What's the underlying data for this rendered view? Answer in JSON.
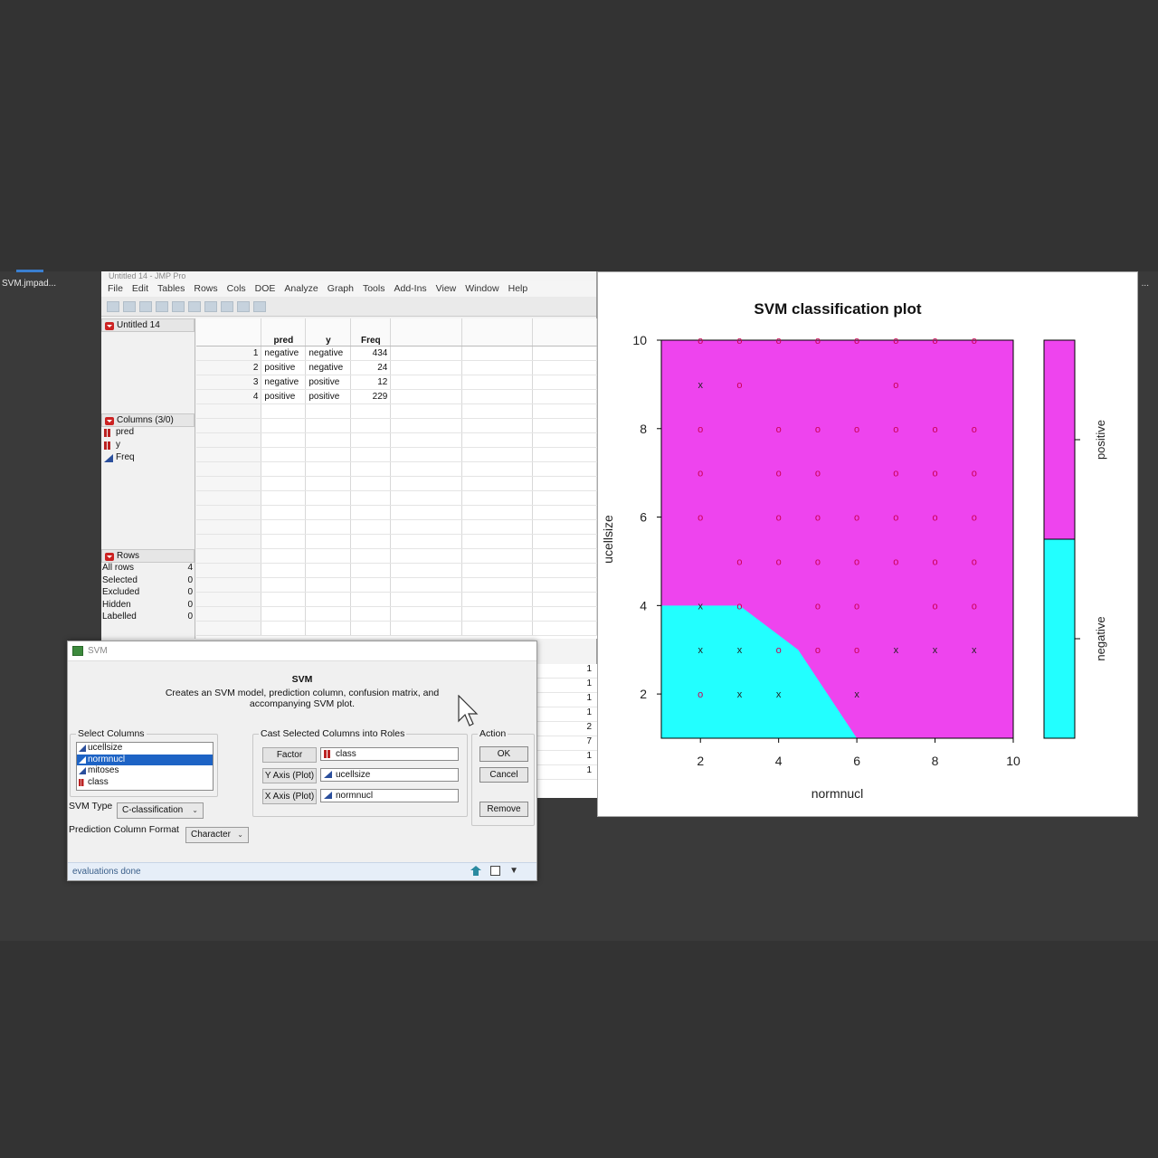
{
  "desktop": {
    "icon_label": "SVM.jmpad...",
    "edge_text": "..."
  },
  "jmp": {
    "title": "Untitled 14 - JMP Pro",
    "menu": [
      "File",
      "Edit",
      "Tables",
      "Rows",
      "Cols",
      "DOE",
      "Analyze",
      "Graph",
      "Tools",
      "Add-Ins",
      "View",
      "Window",
      "Help"
    ],
    "table_name": "Untitled 14",
    "columns_header": "Columns (3/0)",
    "columns": [
      {
        "name": "pred",
        "type": "nominal"
      },
      {
        "name": "y",
        "type": "nominal"
      },
      {
        "name": "Freq",
        "type": "continuous"
      }
    ],
    "rows_header": "Rows",
    "row_stats": [
      {
        "label": "All rows",
        "value": "4"
      },
      {
        "label": "Selected",
        "value": "0"
      },
      {
        "label": "Excluded",
        "value": "0"
      },
      {
        "label": "Hidden",
        "value": "0"
      },
      {
        "label": "Labelled",
        "value": "0"
      }
    ],
    "headers": [
      "pred",
      "y",
      "Freq"
    ],
    "rows": [
      {
        "n": "1",
        "pred": "negative",
        "y": "negative",
        "freq": "434"
      },
      {
        "n": "2",
        "pred": "positive",
        "y": "negative",
        "freq": "24"
      },
      {
        "n": "3",
        "pred": "negative",
        "y": "positive",
        "freq": "12"
      },
      {
        "n": "4",
        "pred": "positive",
        "y": "positive",
        "freq": "229"
      }
    ],
    "behind_values": [
      "1",
      "1",
      "1",
      "1",
      "2",
      "7",
      "1",
      "1"
    ]
  },
  "dialog": {
    "title": "SVM",
    "heading": "SVM",
    "description_line1": "Creates an SVM model, prediction column, confusion matrix, and",
    "description_line2": "accompanying SVM plot.",
    "select_columns_label": "Select Columns",
    "select_columns": [
      {
        "name": "ucellsize",
        "type": "continuous",
        "selected": false
      },
      {
        "name": "normnucl",
        "type": "continuous",
        "selected": true
      },
      {
        "name": "mitoses",
        "type": "continuous",
        "selected": false
      },
      {
        "name": "class",
        "type": "nominal",
        "selected": false
      }
    ],
    "cast_label": "Cast Selected Columns into Roles",
    "roles": [
      {
        "button": "Factor",
        "value": "class"
      },
      {
        "button": "Y Axis (Plot)",
        "value": "ucellsize"
      },
      {
        "button": "X Axis (Plot)",
        "value": "normnucl"
      }
    ],
    "action_label": "Action",
    "ok": "OK",
    "cancel": "Cancel",
    "remove": "Remove",
    "svm_type_label": "SVM Type",
    "svm_type_value": "C-classification",
    "pred_format_label": "Prediction Column Format",
    "pred_format_value": "Character",
    "status": "evaluations done"
  },
  "chart_data": {
    "type": "scatter",
    "title": "SVM classification plot",
    "xlabel": "normnucl",
    "ylabel": "ucellsize",
    "xlim": [
      1,
      10
    ],
    "ylim": [
      1,
      10
    ],
    "xticks": [
      "2",
      "4",
      "6",
      "8",
      "10"
    ],
    "yticks": [
      "2",
      "4",
      "6",
      "8",
      "10"
    ],
    "legend_labels": [
      "negative",
      "positive"
    ],
    "colors": {
      "positive": "#ee44ee",
      "negative": "#22ffff",
      "point": "#cc0055",
      "support": "#222222"
    },
    "negative_region_boundary": [
      [
        1,
        1
      ],
      [
        1,
        4
      ],
      [
        3,
        4
      ],
      [
        4.5,
        3
      ],
      [
        6,
        1
      ]
    ],
    "points": [
      {
        "x": 2,
        "y": 10,
        "m": "o"
      },
      {
        "x": 3,
        "y": 10,
        "m": "o"
      },
      {
        "x": 4,
        "y": 10,
        "m": "o"
      },
      {
        "x": 5,
        "y": 10,
        "m": "o"
      },
      {
        "x": 6,
        "y": 10,
        "m": "o"
      },
      {
        "x": 7,
        "y": 10,
        "m": "o"
      },
      {
        "x": 8,
        "y": 10,
        "m": "o"
      },
      {
        "x": 9,
        "y": 10,
        "m": "o"
      },
      {
        "x": 2,
        "y": 9,
        "m": "x"
      },
      {
        "x": 3,
        "y": 9,
        "m": "o"
      },
      {
        "x": 7,
        "y": 9,
        "m": "o"
      },
      {
        "x": 2,
        "y": 8,
        "m": "o"
      },
      {
        "x": 4,
        "y": 8,
        "m": "o"
      },
      {
        "x": 5,
        "y": 8,
        "m": "o"
      },
      {
        "x": 6,
        "y": 8,
        "m": "o"
      },
      {
        "x": 7,
        "y": 8,
        "m": "o"
      },
      {
        "x": 8,
        "y": 8,
        "m": "o"
      },
      {
        "x": 9,
        "y": 8,
        "m": "o"
      },
      {
        "x": 2,
        "y": 7,
        "m": "o"
      },
      {
        "x": 4,
        "y": 7,
        "m": "o"
      },
      {
        "x": 5,
        "y": 7,
        "m": "o"
      },
      {
        "x": 7,
        "y": 7,
        "m": "o"
      },
      {
        "x": 8,
        "y": 7,
        "m": "o"
      },
      {
        "x": 9,
        "y": 7,
        "m": "o"
      },
      {
        "x": 2,
        "y": 6,
        "m": "o"
      },
      {
        "x": 4,
        "y": 6,
        "m": "o"
      },
      {
        "x": 5,
        "y": 6,
        "m": "o"
      },
      {
        "x": 6,
        "y": 6,
        "m": "o"
      },
      {
        "x": 7,
        "y": 6,
        "m": "o"
      },
      {
        "x": 8,
        "y": 6,
        "m": "o"
      },
      {
        "x": 9,
        "y": 6,
        "m": "o"
      },
      {
        "x": 3,
        "y": 5,
        "m": "o"
      },
      {
        "x": 4,
        "y": 5,
        "m": "o"
      },
      {
        "x": 5,
        "y": 5,
        "m": "o"
      },
      {
        "x": 6,
        "y": 5,
        "m": "o"
      },
      {
        "x": 7,
        "y": 5,
        "m": "o"
      },
      {
        "x": 8,
        "y": 5,
        "m": "o"
      },
      {
        "x": 9,
        "y": 5,
        "m": "o"
      },
      {
        "x": 2,
        "y": 4,
        "m": "x"
      },
      {
        "x": 3,
        "y": 4,
        "m": "o"
      },
      {
        "x": 5,
        "y": 4,
        "m": "o"
      },
      {
        "x": 6,
        "y": 4,
        "m": "o"
      },
      {
        "x": 8,
        "y": 4,
        "m": "o"
      },
      {
        "x": 9,
        "y": 4,
        "m": "o"
      },
      {
        "x": 2,
        "y": 3,
        "m": "x"
      },
      {
        "x": 3,
        "y": 3,
        "m": "x"
      },
      {
        "x": 4,
        "y": 3,
        "m": "o"
      },
      {
        "x": 5,
        "y": 3,
        "m": "o"
      },
      {
        "x": 6,
        "y": 3,
        "m": "o"
      },
      {
        "x": 7,
        "y": 3,
        "m": "x"
      },
      {
        "x": 8,
        "y": 3,
        "m": "x"
      },
      {
        "x": 9,
        "y": 3,
        "m": "x"
      },
      {
        "x": 2,
        "y": 2,
        "m": "o"
      },
      {
        "x": 3,
        "y": 2,
        "m": "x"
      },
      {
        "x": 4,
        "y": 2,
        "m": "x"
      },
      {
        "x": 6,
        "y": 2,
        "m": "x"
      }
    ]
  }
}
